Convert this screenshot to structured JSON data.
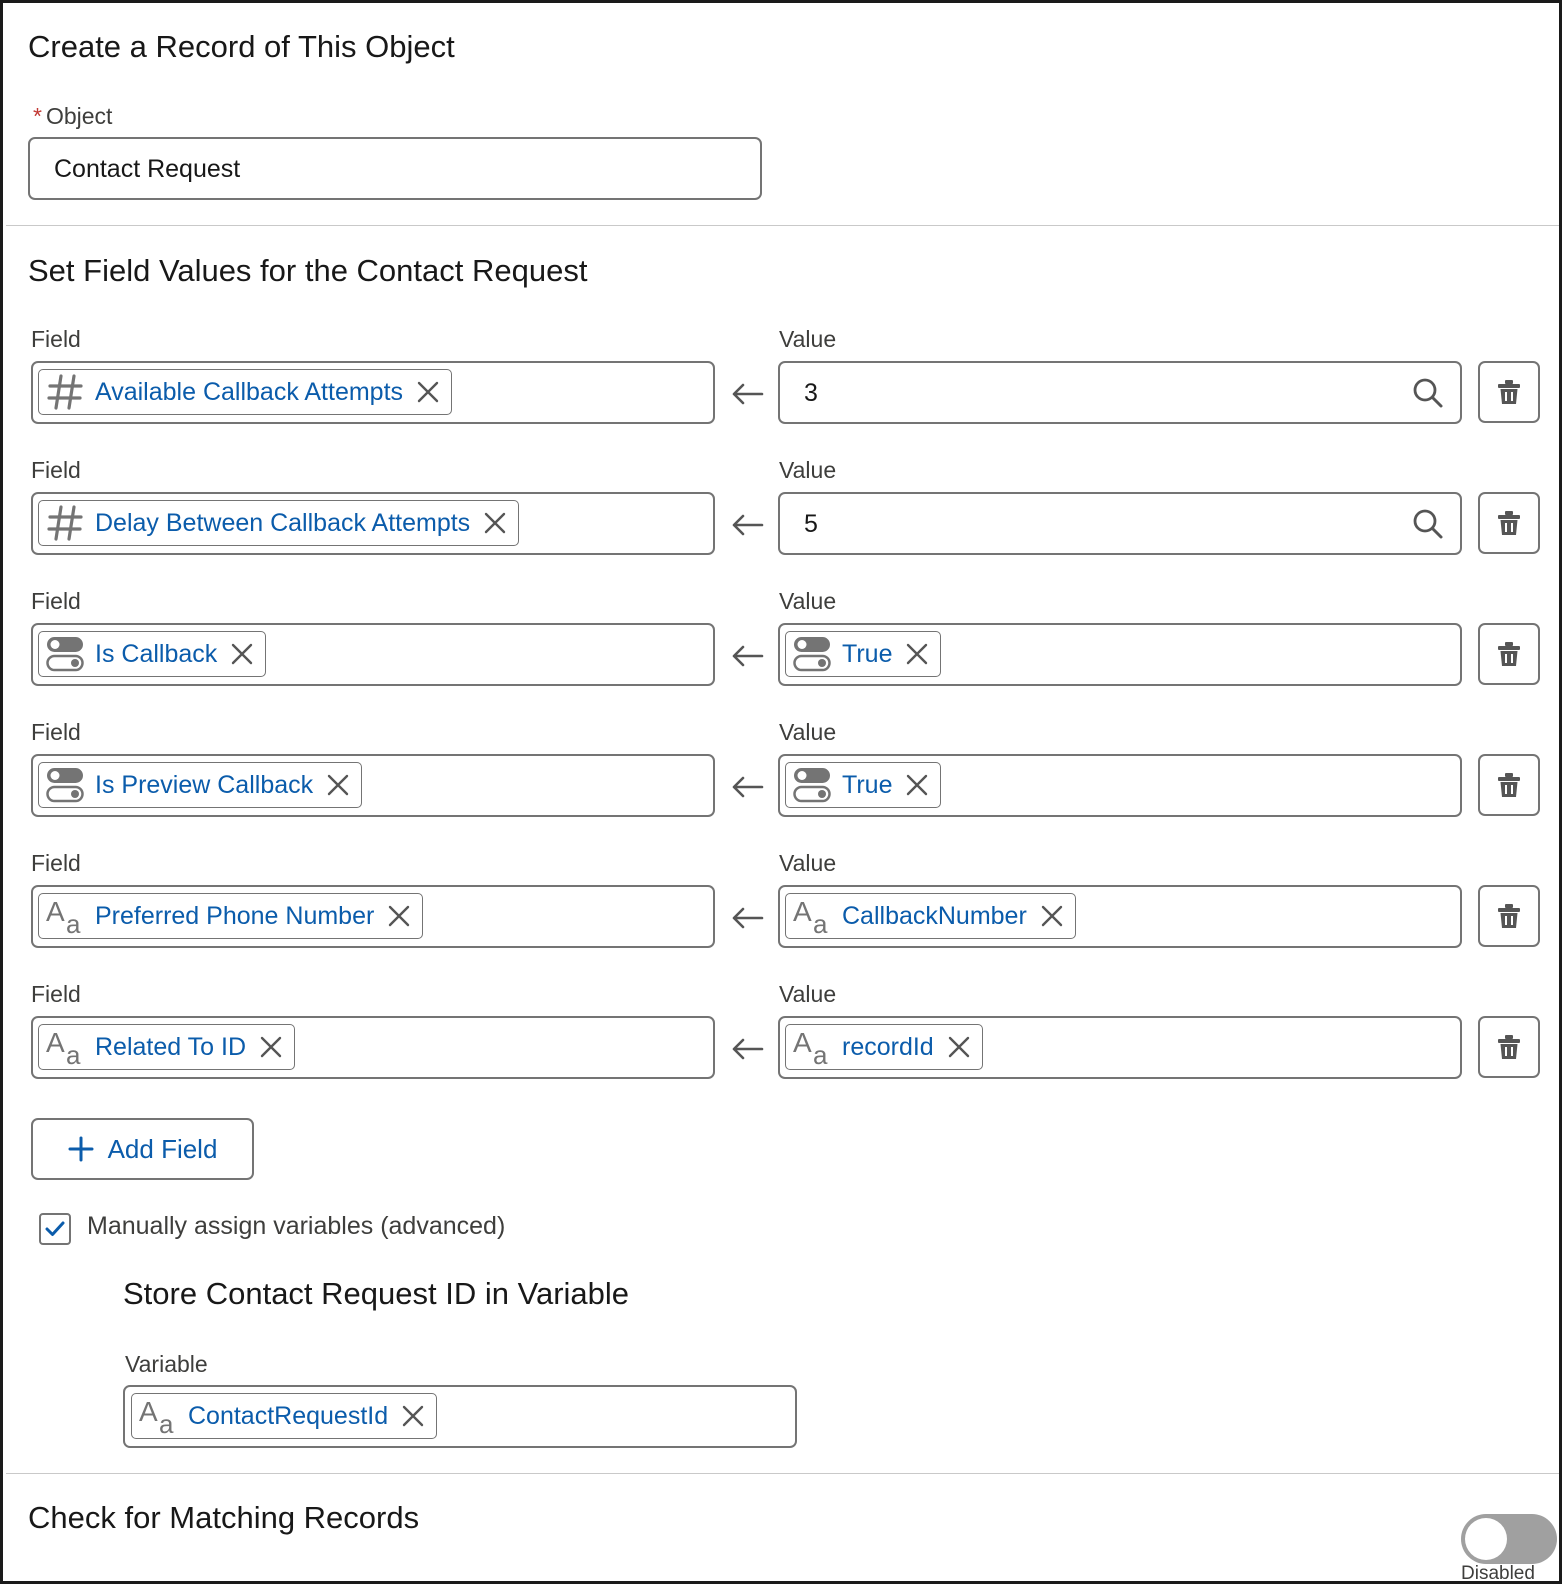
{
  "create_section": {
    "title": "Create a Record of This Object",
    "object_label": "Object",
    "required_marker": "*",
    "object_value": "Contact Request"
  },
  "set_fields_section": {
    "title": "Set Field Values for the Contact Request",
    "field_label": "Field",
    "value_label": "Value",
    "rows": [
      {
        "field": "Available Callback Attempts",
        "field_icon": "number-icon",
        "value": "3",
        "value_type": "text-search"
      },
      {
        "field": "Delay Between Callback Attempts",
        "field_icon": "number-icon",
        "value": "5",
        "value_type": "text-search"
      },
      {
        "field": "Is Callback",
        "field_icon": "toggle-icon",
        "value": "True",
        "value_type": "pill",
        "value_icon": "toggle-icon"
      },
      {
        "field": "Is Preview Callback",
        "field_icon": "toggle-icon",
        "value": "True",
        "value_type": "pill",
        "value_icon": "toggle-icon"
      },
      {
        "field": "Preferred Phone Number",
        "field_icon": "text-icon",
        "value": "CallbackNumber",
        "value_type": "pill",
        "value_icon": "text-icon"
      },
      {
        "field": "Related To ID",
        "field_icon": "text-icon",
        "value": "recordId",
        "value_type": "pill",
        "value_icon": "text-icon"
      }
    ],
    "add_field_label": "Add Field",
    "manual_assign_label": "Manually assign variables (advanced)",
    "manual_assign_checked": true
  },
  "store_section": {
    "title": "Store Contact Request ID in Variable",
    "variable_label": "Variable",
    "variable_value": "ContactRequestId",
    "variable_icon": "text-icon"
  },
  "matching_section": {
    "title": "Check for Matching Records",
    "toggle_label": "Disabled",
    "toggle_on": false
  },
  "colors": {
    "link_blue": "#0b5cab",
    "border_gray": "#747474",
    "icon_gray": "#747474",
    "required_red": "#c23934",
    "toggle_off": "#a0a0a0"
  }
}
